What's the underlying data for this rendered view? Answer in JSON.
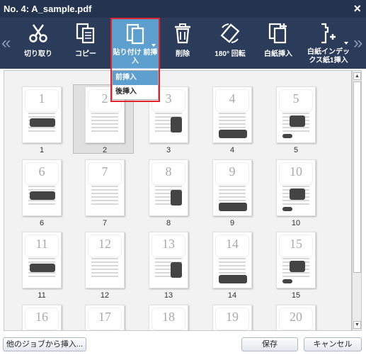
{
  "window": {
    "title": "No. 4: A_sample.pdf",
    "close_icon": "×"
  },
  "toolbar": {
    "left_arrow": "«",
    "right_arrow": "»",
    "buttons": {
      "cut": "切り取り",
      "copy": "コピー",
      "paste_line1": "貼り付け 前挿",
      "paste_line2": "入",
      "delete": "削除",
      "rotate": "180° 回転",
      "blank": "白紙挿入",
      "tab_line1": "白紙インデッ",
      "tab_line2": "クス紙1挿入"
    }
  },
  "paste_menu": {
    "items": [
      "前挿入",
      "後挿入"
    ],
    "selected": "前挿入"
  },
  "pages": [
    "1",
    "2",
    "3",
    "4",
    "5",
    "6",
    "7",
    "8",
    "9",
    "10",
    "11",
    "12",
    "13",
    "14",
    "15",
    "16",
    "17",
    "18",
    "19",
    "20"
  ],
  "selected_page": "2",
  "footer": {
    "insert_label": "他のジョブから挿入...",
    "save_label": "保存",
    "cancel_label": "キャンセル"
  },
  "colors": {
    "titlebar": "#24344f",
    "toolbar": "#2b3c5a",
    "accent": "#5da0cf",
    "highlight": "#e0242a"
  }
}
